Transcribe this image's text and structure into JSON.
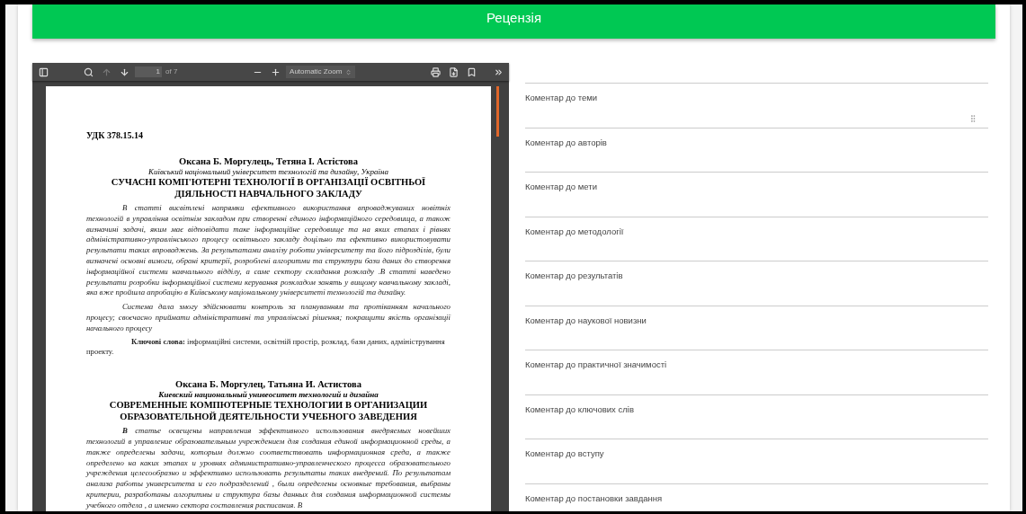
{
  "header": {
    "title": "Рецензія"
  },
  "pdf_viewer": {
    "toolbar": {
      "page_number": "1",
      "page_count": "of 7",
      "zoom": "Automatic Zoom",
      "prev_page": {
        "disabled": true
      },
      "next_page": {
        "disabled": false
      }
    },
    "document": [
      {
        "kind": "udk",
        "text": "УДК  378.15.14"
      },
      {
        "kind": "authors",
        "text": "Оксана Б. Моргулець, Тетяна І. Астістова"
      },
      {
        "kind": "affiliation",
        "text": "Київський національний університет технологій та дизайну, Україна"
      },
      {
        "kind": "title",
        "text": "СУЧАСНІ КОМП'ЮТЕРНІ ТЕХНОЛОГІЇ В ОРГАНІЗАЦІЇ ОСВІТНЬОЇ"
      },
      {
        "kind": "title",
        "text": "ДІЯЛЬНОСТІ  НАВЧАЛЬНОГО ЗАКЛАДУ"
      },
      {
        "kind": "abstract",
        "text": "В статті  висвітлені напрямки ефективного використання впроваджуваних новітніх технологій в управління освітнім закладом при створенні єдиного  інформаційного середовища,  а також визначині задачі, яким має відповідати таке інформаційне середовище та на яких етапах і рівнях адміністративно-управлінського процесу освітнього  закладу доцільно та ефективно використовувати  результати таких впроваджень. За результатами аналізу роботи університету та його підрозділів, були визначені основні вимоги, обрані критерії, розроблені алгоритми та структури бази даних  до створення інформаційної системи навчального відділу, а саме сектору складання розкладу .В статті наведено результати розробки інформаційної  системи керування розкладом занять у вищому навчальному закладі, яка вже пройшла апробацію в Київському національному університеті технологій та дизайну."
      },
      {
        "kind": "abstract",
        "text": "Система дала змогу здійснювати контроль за плануванням та  протіканням начального процесу; своєчасно приймати адміністративні та управлінські рішення; покращити якість організації начального процесу"
      },
      {
        "kind": "keywords",
        "text": "**Ключові слова:** інформаційні системи, освітній простір, розклад, бази даних,  адміністрування проекту."
      },
      {
        "kind": "authors",
        "text": "Оксана Б. Моргулец, Татьяна И. Астистова"
      },
      {
        "kind": "affiliation_bold",
        "text": "Киевский национальный унивеоситет технологий и дизайна"
      },
      {
        "kind": "title",
        "text": "СОВРЕМЕННЫЕ КОМПЮТЕРНЫЕ ТЕХНОЛОГИИ В ОРГАНИЗАЦИИ"
      },
      {
        "kind": "title",
        "text": "ОБРАЗОВАТЕЛЬНОЙ ДЕЯТЕЛЬНОСТИ УЧЕБНОГО ЗАВЕДЕНИЯ"
      },
      {
        "kind": "abstract",
        "text": "**В** статье освещены  направления эффективного использования внедряемых новейших технологий в управление образовательным учреждением для создания единой информационной среды, а также определены задачи,  которым должно соответствовать информационная среда, а также определено  на каких этапах и уровнях административно-управленческого процесса образовательного учреждения целесообразно и эффективно использовать результаты таких внедрений.  По результатам анализа работы университета и его подразделений , были определены основные требования, выбраны критерии, разработаны алгоритмы и структура базы данных для создания информационной системы учебного отдела , а именно сектора составления расписания. В"
      }
    ]
  },
  "comments": [
    {
      "label": "Коментар до теми"
    },
    {
      "label": "Коментар до авторів"
    },
    {
      "label": "Коментар до мети"
    },
    {
      "label": "Коментар до методології"
    },
    {
      "label": "Коментар до результатів"
    },
    {
      "label": "Коментар до наукової новизни"
    },
    {
      "label": "Коментар до практичної значимості"
    },
    {
      "label": "Коментар до ключових слів"
    },
    {
      "label": "Коментар до вступу"
    },
    {
      "label": "Коментар до постановки завдання"
    }
  ]
}
